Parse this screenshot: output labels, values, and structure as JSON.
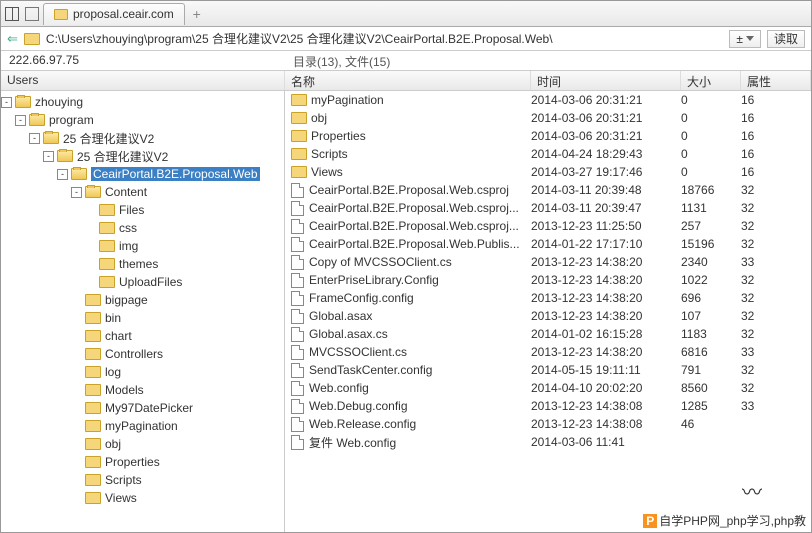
{
  "tab": {
    "title": "proposal.ceair.com"
  },
  "address": {
    "path": "C:\\Users\\zhouying\\program\\25 合理化建议V2\\25 合理化建议V2\\CeairPortal.B2E.Proposal.Web\\",
    "btn1": "±",
    "btn2": "读取"
  },
  "info": {
    "ip": "222.66.97.75",
    "counts": "目录(13), 文件(15)"
  },
  "headers": {
    "name": "名称",
    "time": "时间",
    "size": "大小",
    "attr": "属性"
  },
  "tree_header": "Users",
  "tree": [
    {
      "indent": 0,
      "tw": "-",
      "open": true,
      "label": "zhouying"
    },
    {
      "indent": 1,
      "tw": "-",
      "open": true,
      "label": "program"
    },
    {
      "indent": 2,
      "tw": "-",
      "open": true,
      "label": "25 合理化建议V2"
    },
    {
      "indent": 3,
      "tw": "-",
      "open": true,
      "label": "25 合理化建议V2"
    },
    {
      "indent": 4,
      "tw": "-",
      "open": true,
      "label": "CeairPortal.B2E.Proposal.Web",
      "sel": true
    },
    {
      "indent": 5,
      "tw": "-",
      "open": true,
      "label": "Content"
    },
    {
      "indent": 6,
      "tw": "",
      "open": false,
      "label": "Files"
    },
    {
      "indent": 6,
      "tw": "",
      "open": false,
      "label": "css"
    },
    {
      "indent": 6,
      "tw": "",
      "open": false,
      "label": "img"
    },
    {
      "indent": 6,
      "tw": "",
      "open": false,
      "label": "themes"
    },
    {
      "indent": 6,
      "tw": "",
      "open": false,
      "label": "UploadFiles"
    },
    {
      "indent": 5,
      "tw": "",
      "open": false,
      "label": "bigpage"
    },
    {
      "indent": 5,
      "tw": "",
      "open": false,
      "label": "bin"
    },
    {
      "indent": 5,
      "tw": "",
      "open": false,
      "label": "chart"
    },
    {
      "indent": 5,
      "tw": "",
      "open": false,
      "label": "Controllers"
    },
    {
      "indent": 5,
      "tw": "",
      "open": false,
      "label": "log"
    },
    {
      "indent": 5,
      "tw": "",
      "open": false,
      "label": "Models"
    },
    {
      "indent": 5,
      "tw": "",
      "open": false,
      "label": "My97DatePicker"
    },
    {
      "indent": 5,
      "tw": "",
      "open": false,
      "label": "myPagination"
    },
    {
      "indent": 5,
      "tw": "",
      "open": false,
      "label": "obj"
    },
    {
      "indent": 5,
      "tw": "",
      "open": false,
      "label": "Properties"
    },
    {
      "indent": 5,
      "tw": "",
      "open": false,
      "label": "Scripts"
    },
    {
      "indent": 5,
      "tw": "",
      "open": false,
      "label": "Views"
    }
  ],
  "files": [
    {
      "t": "d",
      "name": "myPagination",
      "time": "2014-03-06 20:31:21",
      "size": "0",
      "attr": "16"
    },
    {
      "t": "d",
      "name": "obj",
      "time": "2014-03-06 20:31:21",
      "size": "0",
      "attr": "16"
    },
    {
      "t": "d",
      "name": "Properties",
      "time": "2014-03-06 20:31:21",
      "size": "0",
      "attr": "16"
    },
    {
      "t": "d",
      "name": "Scripts",
      "time": "2014-04-24 18:29:43",
      "size": "0",
      "attr": "16"
    },
    {
      "t": "d",
      "name": "Views",
      "time": "2014-03-27 19:17:46",
      "size": "0",
      "attr": "16"
    },
    {
      "t": "f",
      "name": "CeairPortal.B2E.Proposal.Web.csproj",
      "time": "2014-03-11 20:39:48",
      "size": "18766",
      "attr": "32"
    },
    {
      "t": "f",
      "name": "CeairPortal.B2E.Proposal.Web.csproj...",
      "time": "2014-03-11 20:39:47",
      "size": "1131",
      "attr": "32"
    },
    {
      "t": "f",
      "name": "CeairPortal.B2E.Proposal.Web.csproj...",
      "time": "2013-12-23 11:25:50",
      "size": "257",
      "attr": "32"
    },
    {
      "t": "f",
      "name": "CeairPortal.B2E.Proposal.Web.Publis...",
      "time": "2014-01-22 17:17:10",
      "size": "15196",
      "attr": "32"
    },
    {
      "t": "f",
      "name": "Copy of MVCSSOClient.cs",
      "time": "2013-12-23 14:38:20",
      "size": "2340",
      "attr": "33"
    },
    {
      "t": "f",
      "name": "EnterPriseLibrary.Config",
      "time": "2013-12-23 14:38:20",
      "size": "1022",
      "attr": "32"
    },
    {
      "t": "f",
      "name": "FrameConfig.config",
      "time": "2013-12-23 14:38:20",
      "size": "696",
      "attr": "32"
    },
    {
      "t": "f",
      "name": "Global.asax",
      "time": "2013-12-23 14:38:20",
      "size": "107",
      "attr": "32"
    },
    {
      "t": "f",
      "name": "Global.asax.cs",
      "time": "2014-01-02 16:15:28",
      "size": "1183",
      "attr": "32"
    },
    {
      "t": "f",
      "name": "MVCSSOClient.cs",
      "time": "2013-12-23 14:38:20",
      "size": "6816",
      "attr": "33"
    },
    {
      "t": "f",
      "name": "SendTaskCenter.config",
      "time": "2014-05-15 19:11:11",
      "size": "791",
      "attr": "32"
    },
    {
      "t": "f",
      "name": "Web.config",
      "time": "2014-04-10 20:02:20",
      "size": "8560",
      "attr": "32"
    },
    {
      "t": "f",
      "name": "Web.Debug.config",
      "time": "2013-12-23 14:38:08",
      "size": "1285",
      "attr": "33"
    },
    {
      "t": "f",
      "name": "Web.Release.config",
      "time": "2013-12-23 14:38:08",
      "size": "46",
      "attr": ""
    },
    {
      "t": "f",
      "name": "复件 Web.config",
      "time": "2014-03-06 11:41",
      "size": "",
      "attr": ""
    }
  ],
  "watermark": "自学PHP网_php学习,php教"
}
